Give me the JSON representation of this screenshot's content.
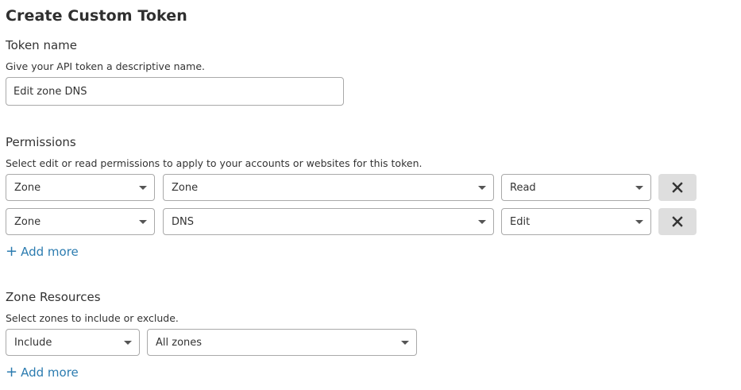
{
  "page": {
    "title": "Create Custom Token"
  },
  "token_name": {
    "label": "Token name",
    "help": "Give your API token a descriptive name.",
    "value": "Edit zone DNS"
  },
  "permissions": {
    "label": "Permissions",
    "help": "Select edit or read permissions to apply to your accounts or websites for this token.",
    "rows": [
      {
        "scope": "Zone",
        "resource": "Zone",
        "access": "Read"
      },
      {
        "scope": "Zone",
        "resource": "DNS",
        "access": "Edit"
      }
    ],
    "add_more": "Add more"
  },
  "zone_resources": {
    "label": "Zone Resources",
    "help": "Select zones to include or exclude.",
    "mode": "Include",
    "zones": "All zones",
    "add_more": "Add more"
  },
  "icons": {
    "remove": "close-icon",
    "caret": "chevron-down-icon",
    "add": "plus-icon"
  },
  "colors": {
    "link": "#2c7cb0",
    "remove_bg": "#dedede",
    "border": "#a9a9a9"
  }
}
